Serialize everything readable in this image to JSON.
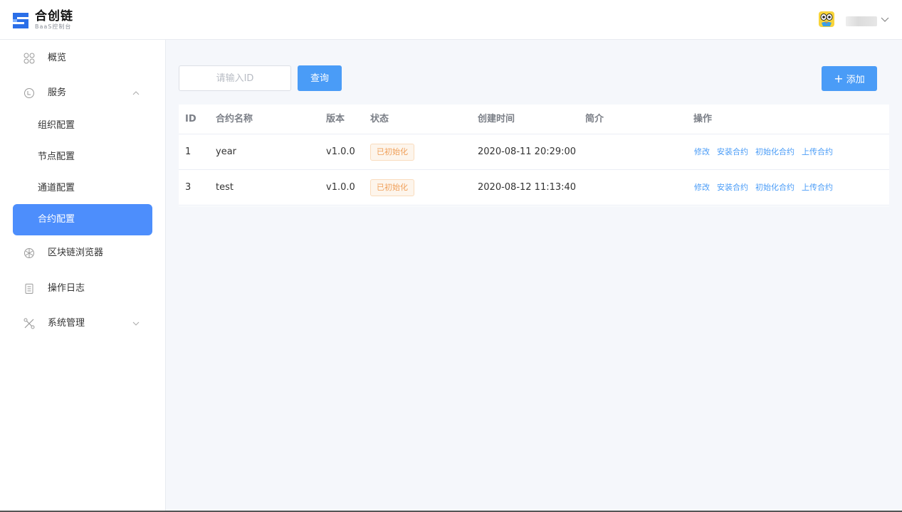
{
  "header": {
    "logo_title": "合创链",
    "logo_subtitle": "BaaS控制台",
    "brand_color": "#2b6fe8",
    "avatar_icon": "qq-penguin-avatar",
    "chevron_icon": "chevron-down-icon"
  },
  "sidebar": {
    "items": [
      {
        "label": "概览",
        "icon": "grid-icon"
      },
      {
        "label": "服务",
        "icon": "service-icon",
        "expanded": true
      },
      {
        "label": "区块链浏览器",
        "icon": "globe-icon"
      },
      {
        "label": "操作日志",
        "icon": "log-icon"
      },
      {
        "label": "系统管理",
        "icon": "tools-icon",
        "expanded": false
      }
    ],
    "service_children": [
      "组织配置",
      "节点配置",
      "通道配置",
      "合约配置"
    ],
    "active_child": "合约配置",
    "active_color": "#4d8efc"
  },
  "toolbar": {
    "search_placeholder": "请输入ID",
    "query_label": "查询",
    "add_label": "添加",
    "accent_color": "#4a9cf7"
  },
  "table": {
    "columns": [
      "ID",
      "合约名称",
      "版本",
      "状态",
      "创建时间",
      "简介",
      "操作"
    ],
    "rows": [
      {
        "id": "1",
        "name": "year",
        "version": "v1.0.0",
        "status": "已初始化",
        "created": "2020-08-11 20:29:00",
        "intro": ""
      },
      {
        "id": "3",
        "name": "test",
        "version": "v1.0.0",
        "status": "已初始化",
        "created": "2020-08-12 11:13:40",
        "intro": ""
      }
    ],
    "actions": [
      "修改",
      "安装合约",
      "初始化合约",
      "上传合约"
    ]
  }
}
